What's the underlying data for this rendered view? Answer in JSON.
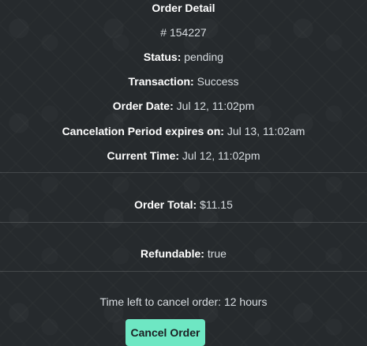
{
  "order": {
    "heading": "Order Detail",
    "number": "# 154227",
    "status_label": "Status:",
    "status_value": "pending",
    "transaction_label": "Transaction:",
    "transaction_value": "Success",
    "order_date_label": "Order Date:",
    "order_date_value": "Jul 12, 11:02pm",
    "cancel_period_label": "Cancelation Period expires on:",
    "cancel_period_value": "Jul 13, 11:02am",
    "current_time_label": "Current Time:",
    "current_time_value": "Jul 12, 11:02pm",
    "total_label": "Order Total:",
    "total_value": "$11.15",
    "refundable_label": "Refundable:",
    "refundable_value": "true",
    "time_left_text": "Time left to cancel order: 12 hours",
    "cancel_button_label": "Cancel Order"
  },
  "colors": {
    "background": "#262a2d",
    "button": "#6ee7c3",
    "text": "#e9ecef"
  }
}
